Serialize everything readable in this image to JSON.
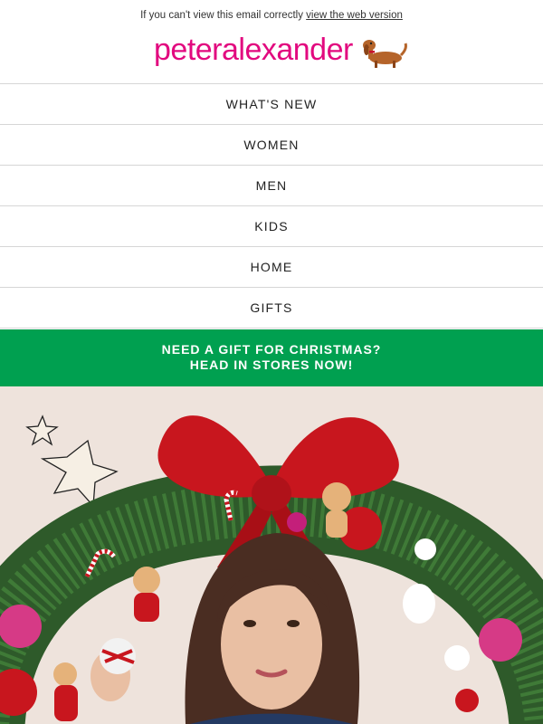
{
  "preheader": {
    "text": "If you can't view this email correctly",
    "link": "view the web version"
  },
  "brand": {
    "logo_text": "peteralexander",
    "color": "#e2097f"
  },
  "nav": {
    "items": [
      {
        "label": "WHAT'S NEW"
      },
      {
        "label": "WOMEN"
      },
      {
        "label": "MEN"
      },
      {
        "label": "KIDS"
      },
      {
        "label": "HOME"
      },
      {
        "label": "GIFTS"
      }
    ]
  },
  "banner": {
    "line1": "NEED A GIFT FOR CHRISTMAS?",
    "line2": "HEAD IN STORES NOW!",
    "color": "#00a050"
  },
  "hero": {
    "background": "#eee3dc",
    "description_icon": "christmas-wreath-portrait-image"
  }
}
